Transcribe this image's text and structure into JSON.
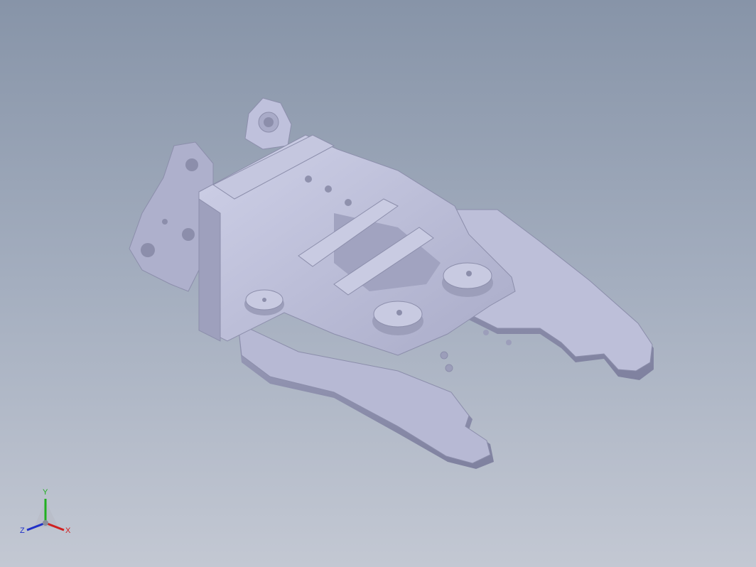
{
  "viewport": {
    "background_top": "#8794a8",
    "background_bottom": "#c3c8d3",
    "model_color": "#b9bbd6",
    "model_shadow": "#8f91ad",
    "model_highlight": "#d6d8ec"
  },
  "axis_triad": {
    "x_label": "X",
    "y_label": "Y",
    "z_label": "Z",
    "x_color": "#d02020",
    "y_color": "#20b020",
    "z_color": "#2030c8"
  }
}
